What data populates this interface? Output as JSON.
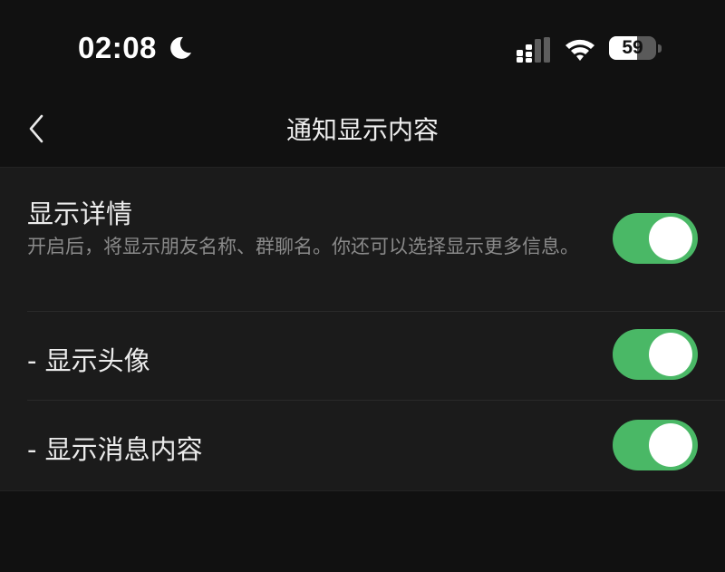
{
  "status_bar": {
    "time": "02:08",
    "battery": "59",
    "battery_level": 0.59,
    "icons": [
      "moon-icon",
      "signal-icon",
      "wifi-icon",
      "battery-icon"
    ]
  },
  "nav": {
    "title": "通知显示内容",
    "back_icon": "chevron-left-icon"
  },
  "settings": [
    {
      "label": "显示详情",
      "description": "开启后，将显示朋友名称、群聊名。你还可以选择显示更多信息。",
      "enabled": true
    },
    {
      "label": "- 显示头像",
      "enabled": true
    },
    {
      "label": "- 显示消息内容",
      "enabled": true
    }
  ],
  "colors": {
    "background": "#111111",
    "panel": "#1b1b1b",
    "toggle_on": "#4ab866"
  }
}
